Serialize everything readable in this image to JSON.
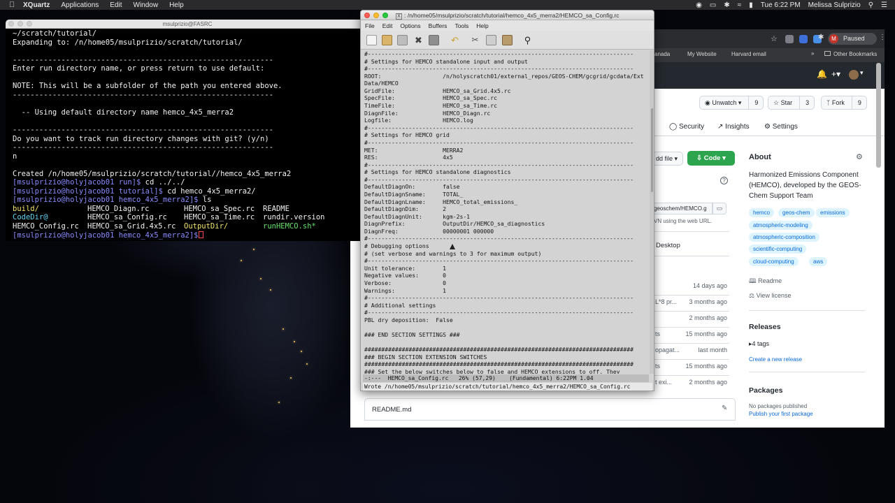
{
  "menubar": {
    "app": "XQuartz",
    "items": [
      "Applications",
      "Edit",
      "Window",
      "Help"
    ],
    "clock": "Tue 6:22 PM",
    "user": "Melissa Sulprizio"
  },
  "terminal": {
    "title": "msulprizio@FASRC",
    "lines": [
      "~/scratch/tutorial/",
      "Expanding to: /n/home05/msulprizio/scratch/tutorial/",
      "",
      "-----------------------------------------------------------",
      "Enter run directory name, or press return to use default:",
      "",
      "NOTE: This will be a subfolder of the path you entered above.",
      "-----------------------------------------------------------",
      "",
      "  -- Using default directory name hemco_4x5_merra2",
      "",
      "-----------------------------------------------------------",
      "Do you want to track run directory changes with git? (y/n)",
      "-----------------------------------------------------------",
      "n",
      "",
      "Created /n/home05/msulprizio/scratch/tutorial//hemco_4x5_merra2"
    ],
    "prompt1": "[msulprizio@holyjacob01 run]$",
    "cmd1": " cd ../../",
    "prompt2": "[msulprizio@holyjacob01 tutorial]$",
    "cmd2": " cd hemco_4x5_merra2/",
    "prompt3": "[msulprizio@holyjacob01 hemco_4x5_merra2]$",
    "cmd3": " ls",
    "ls": {
      "r1": [
        "build/",
        "HEMCO_Diagn.rc",
        "HEMCO_sa_Spec.rc",
        "README"
      ],
      "r2": [
        "CodeDir@",
        "HEMCO_sa_Config.rc",
        "HEMCO_sa_Time.rc",
        "rundir.version"
      ],
      "r3": [
        "HEMCO_Config.rc",
        "HEMCO_sa_Grid.4x5.rc",
        "OutputDir/",
        "runHEMCO.sh*"
      ]
    },
    "prompt4": "[msulprizio@holyjacob01 hemco_4x5_merra2]$"
  },
  "emacs": {
    "title": ": /n/home05/msulprizio/scratch/tutorial/hemco_4x5_merra2/HEMCO_sa_Config.rc",
    "menu": [
      "File",
      "Edit",
      "Options",
      "Buffers",
      "Tools",
      "Help"
    ],
    "buffer_lines": [
      "#------------------------------------------------------------------------------",
      "# Settings for HEMCO standalone input and output",
      "#------------------------------------------------------------------------------",
      "ROOT:                  /n/holyscratch01/external_repos/GEOS-CHEM/gcgrid/gcdata/Ext",
      "Data/HEMCO",
      "GridFile:              HEMCO_sa_Grid.4x5.rc",
      "SpecFile:              HEMCO_sa_Spec.rc",
      "TimeFile:              HEMCO_sa_Time.rc",
      "DiagnFile:             HEMCO_Diagn.rc",
      "Logfile:               HEMCO.log",
      "#------------------------------------------------------------------------------",
      "# Settings for HEMCO grid",
      "#------------------------------------------------------------------------------",
      "MET:                   MERRA2",
      "RES:                   4x5",
      "#------------------------------------------------------------------------------",
      "# Settings for HEMCO standalone diagnostics",
      "#------------------------------------------------------------------------------",
      "DefaultDiagnOn:        false",
      "DefaultDiagnSname:     TOTAL_",
      "DefaultDiagnLname:     HEMCO_total_emissions_",
      "DefaultDiagnDim:       2",
      "DefaultDiagnUnit:      kgm-2s-1",
      "DiagnPrefix:           OutputDir/HEMCO_sa_diagnostics",
      "DiagnFreq:             00000001 000000",
      "#------------------------------------------------------------------------------",
      "# Debugging options",
      "# (set verbose and warnings to 3 for maximum output)",
      "#------------------------------------------------------------------------------",
      "Unit tolerance:        1",
      "Negative values:       0",
      "Verbose:               0",
      "Warnings:              1",
      "#------------------------------------------------------------------------------",
      "# Additional settings",
      "#------------------------------------------------------------------------------",
      "PBL dry deposition:  False",
      "",
      "### END SECTION SETTINGS ###",
      "",
      "###############################################################################",
      "### BEGIN SECTION EXTENSION SWITCHES",
      "###############################################################################",
      "### Set the below switches below to false and HEMCO extensions to off. They"
    ],
    "modeline": "-:---  HEMCO_sa_Config.rc   26% (57,29)    (Fundamental) 6:22PM 1.04",
    "echo": "Wrote /n/home05/msulprizio/scratch/tutorial/hemco_4x5_merra2/HEMCO_sa_Config.rc"
  },
  "browser": {
    "paused": "Paused",
    "avatar_letter": "M",
    "bookmarks": [
      "anada",
      "My Website",
      "Harvard email",
      "Other Bookmarks"
    ],
    "unwatch": {
      "label": "Unwatch",
      "count": "9"
    },
    "star": {
      "label": "Star",
      "count": "3"
    },
    "fork": {
      "label": "Fork",
      "count": "9"
    },
    "nav": [
      "Security",
      "Insights",
      "Settings"
    ],
    "add_file": "dd file",
    "code": "Code",
    "clone_url": "geoschem/HEMCO.g",
    "svn_hint": "VN using the web URL.",
    "desktop_label": "Desktop",
    "about_title": "About",
    "about_desc": "Harmonized Emissions Component (HEMCO), developed by the GEOS-Chem Support Team",
    "topics": [
      "hemco",
      "geos-chem",
      "emissions",
      "atmospheric-modeling",
      "atmospheric-composition",
      "scientific-computing",
      "cloud-computing",
      "aws"
    ],
    "readme_link": "Readme",
    "license_link": "View license",
    "releases_title": "Releases",
    "tags": "4 tags",
    "create_release": "Create a new release",
    "packages_title": "Packages",
    "no_packages": "No packages published",
    "publish_package": "Publish your first package",
    "file_frags": [
      "L*8 pr...",
      "opagat...",
      "t exi..."
    ],
    "file_dates": [
      "14 days ago",
      "3 months ago",
      "2 months ago",
      "15 months ago",
      "last month",
      "15 months ago",
      "2 months ago"
    ],
    "readme_file": "README.md"
  }
}
